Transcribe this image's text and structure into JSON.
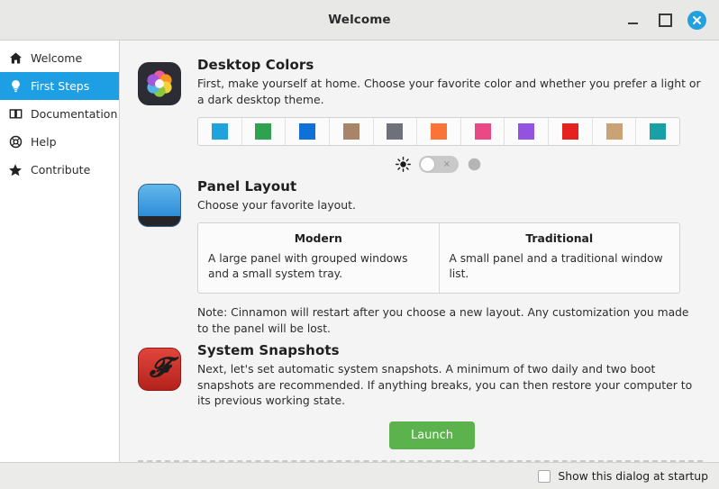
{
  "window": {
    "title": "Welcome",
    "controls": {
      "minimize": "minimize",
      "maximize": "maximize",
      "close": "×"
    }
  },
  "sidebar": {
    "items": [
      {
        "label": "Welcome",
        "icon": "home-icon",
        "active": false
      },
      {
        "label": "First Steps",
        "icon": "lightbulb-icon",
        "active": true
      },
      {
        "label": "Documentation",
        "icon": "book-icon",
        "active": false
      },
      {
        "label": "Help",
        "icon": "lifebuoy-icon",
        "active": false
      },
      {
        "label": "Contribute",
        "icon": "star-icon",
        "active": false
      }
    ]
  },
  "sections": {
    "desktop_colors": {
      "icon": "desktop-colors-icon",
      "title": "Desktop Colors",
      "description": "First, make yourself at home. Choose your favorite color and whether you prefer a light or a dark desktop theme.",
      "swatches": [
        {
          "name": "blue-sky",
          "color": "#1fa3dd"
        },
        {
          "name": "green",
          "color": "#2fa24f"
        },
        {
          "name": "blue",
          "color": "#0f70d8"
        },
        {
          "name": "brown",
          "color": "#a98468"
        },
        {
          "name": "grey",
          "color": "#6e717a"
        },
        {
          "name": "orange",
          "color": "#fa7438"
        },
        {
          "name": "pink",
          "color": "#e94a85"
        },
        {
          "name": "purple",
          "color": "#9352e0"
        },
        {
          "name": "red",
          "color": "#e42220"
        },
        {
          "name": "sand",
          "color": "#c9a275"
        },
        {
          "name": "teal",
          "color": "#17a1a6"
        }
      ],
      "theme_toggle": {
        "light_icon": "sun-icon",
        "dark_icon": "moon-icon",
        "state": "off",
        "off_mark": "×"
      }
    },
    "panel_layout": {
      "icon": "panel-layout-icon",
      "title": "Panel Layout",
      "description": "Choose your favorite layout.",
      "options": [
        {
          "name": "Modern",
          "description": "A large panel with grouped windows and a small system tray."
        },
        {
          "name": "Traditional",
          "description": "A small panel and a traditional window list."
        }
      ],
      "note": "Note: Cinnamon will restart after you choose a new layout. Any customization you made to the panel will be lost."
    },
    "system_snapshots": {
      "icon": "timeshift-icon",
      "title": "System Snapshots",
      "description": "Next, let's set automatic system snapshots. A minimum of two daily and two boot snapshots are recommended. If anything breaks, you can then restore your computer to its previous working state.",
      "launch_label": "Launch"
    }
  },
  "statusbar": {
    "checkbox_label": "Show this dialog at startup",
    "checked": false
  },
  "colors": {
    "accent": "#1e9fe3",
    "launch_green": "#5cb24d",
    "sidebar_bg": "#ffffff",
    "content_bg": "#f4f4f4",
    "titlebar_bg": "#e8e8e7"
  }
}
